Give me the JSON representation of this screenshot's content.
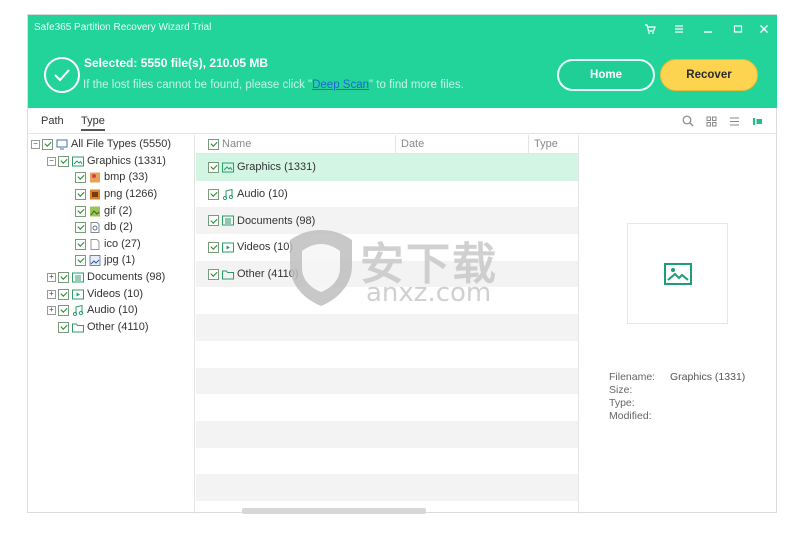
{
  "app": {
    "title": "Safe365 Partition Recovery Wizard Trial",
    "accent": "#22d39a",
    "window_controls": [
      "cart-icon",
      "menu-icon",
      "minimize-icon",
      "maximize-icon",
      "close-icon"
    ]
  },
  "banner": {
    "selected": "Selected: 5550 file(s), 210.05 MB",
    "hint_before": "If the lost files cannot be found, please click \"",
    "hint_link": "Deep Scan",
    "hint_after": "\" to find more files.",
    "home_label": "Home",
    "recover_label": "Recover"
  },
  "tabs": [
    {
      "label": "Path"
    },
    {
      "label": "Type"
    }
  ],
  "tree": {
    "root": "All File Types (5550)",
    "graphics": "Graphics (1331)",
    "bmp": "bmp (33)",
    "png": "png (1266)",
    "gif": "gif (2)",
    "db": "db (2)",
    "ico": "ico (27)",
    "jpg": "jpg (1)",
    "documents": "Documents (98)",
    "videos": "Videos (10)",
    "audio": "Audio (10)",
    "other": "Other (4110)"
  },
  "list": {
    "columns": {
      "name": "Name",
      "date": "Date",
      "type": "Type"
    },
    "rows": [
      {
        "name": "Graphics (1331)"
      },
      {
        "name": "Audio (10)"
      },
      {
        "name": "Documents (98)"
      },
      {
        "name": "Videos (10)"
      },
      {
        "name": "Other (4110)"
      }
    ]
  },
  "preview": {
    "filename_label": "Filename:",
    "filename_value": "Graphics (1331)",
    "size_label": "Size:",
    "type_label": "Type:",
    "modified_label": "Modified:"
  },
  "watermark": {
    "cn": "安下载",
    "en": "anxz.com"
  }
}
